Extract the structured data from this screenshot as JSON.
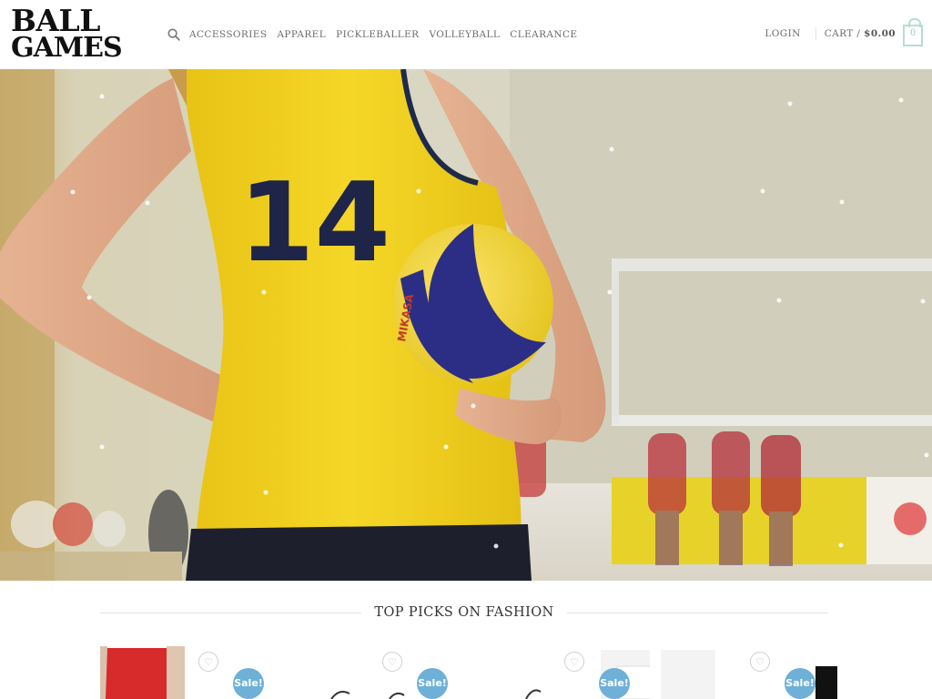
{
  "brand": {
    "line1": "BALL",
    "line2": "GAMES"
  },
  "nav": {
    "search_icon": "search-icon",
    "items": [
      "ACCESSORIES",
      "APPAREL",
      "PICKLEBALLER",
      "VOLLEYBALL",
      "CLEARANCE"
    ]
  },
  "header_right": {
    "login": "LOGIN",
    "cart_label": "CART /",
    "cart_total": "$0.00",
    "cart_count": "0"
  },
  "hero": {
    "jersey_number": "14",
    "ball_brand": "MIKASA"
  },
  "section": {
    "title": "TOP PICKS ON FASHION"
  },
  "products": [
    {
      "badge": "Sale!",
      "wishlist_icon": "heart-icon"
    },
    {
      "badge": "Sale!",
      "wishlist_icon": "heart-icon"
    },
    {
      "badge": "Sale!",
      "wishlist_icon": "heart-icon"
    },
    {
      "badge": "Sale!",
      "wishlist_icon": "heart-icon"
    }
  ],
  "colors": {
    "accent": "#6fb0d8",
    "cart_outline": "#b7dcd5",
    "jersey_yellow": "#f2d21b",
    "ball_blue": "#2c2e86"
  }
}
